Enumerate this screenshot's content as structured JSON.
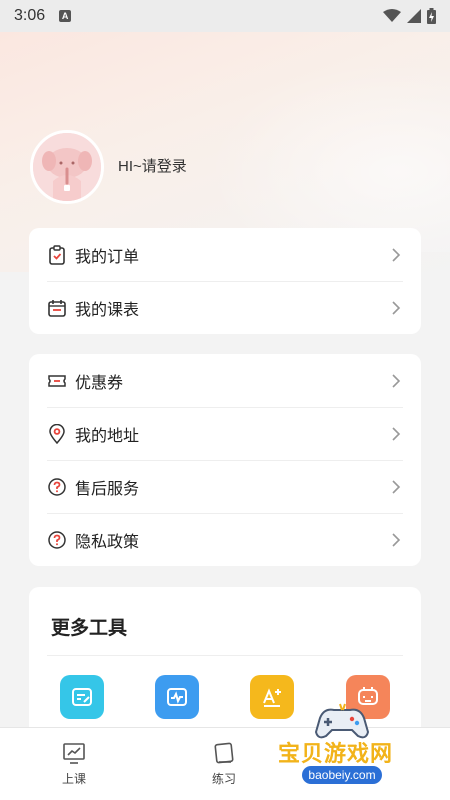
{
  "status_bar": {
    "time": "3:06",
    "notif_icon": "A"
  },
  "profile": {
    "login_text": "HI~请登录"
  },
  "menu_group_1": [
    {
      "label": "我的订单",
      "icon": "clipboard-check-icon"
    },
    {
      "label": "我的课表",
      "icon": "calendar-icon"
    }
  ],
  "menu_group_2": [
    {
      "label": "优惠券",
      "icon": "coupon-icon"
    },
    {
      "label": "我的地址",
      "icon": "location-pin-icon"
    },
    {
      "label": "售后服务",
      "icon": "question-circle-icon"
    },
    {
      "label": "隐私政策",
      "icon": "question-circle-icon"
    }
  ],
  "tools": {
    "title": "更多工具",
    "items": [
      {
        "icon": "note-edit-icon",
        "color": "#35c6e8"
      },
      {
        "icon": "image-chart-icon",
        "color": "#3d9cf0"
      },
      {
        "icon": "font-plus-icon",
        "color": "#f5b81c"
      },
      {
        "icon": "chat-bot-icon",
        "color": "#f5855a"
      }
    ]
  },
  "tab_bar": {
    "items": [
      {
        "label": "上课",
        "icon": "chart-board-icon"
      },
      {
        "label": "练习",
        "icon": "notebook-icon"
      }
    ]
  },
  "watermark": {
    "title": "宝贝游戏网",
    "sub": "baobeiy.com"
  }
}
